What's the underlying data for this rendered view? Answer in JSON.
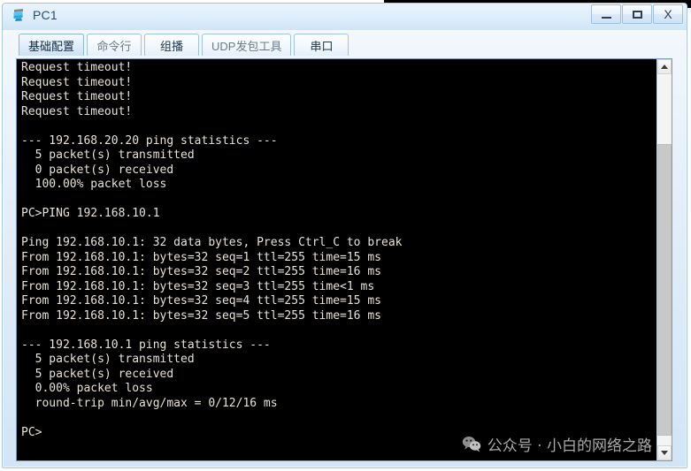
{
  "window": {
    "title": "PC1",
    "icon": "pc-device-icon",
    "controls": [
      {
        "name": "minimize",
        "label": "_"
      },
      {
        "name": "maximize",
        "label": "□"
      },
      {
        "name": "close",
        "label": "X"
      }
    ]
  },
  "tabs": [
    {
      "label": "基础配置",
      "active": true
    },
    {
      "label": "命令行",
      "active": false
    },
    {
      "label": "组播",
      "active": false
    },
    {
      "label": "UDP发包工具",
      "active": false
    },
    {
      "label": "串口",
      "active": false
    }
  ],
  "terminal": {
    "lines": [
      "Request timeout!",
      "Request timeout!",
      "Request timeout!",
      "Request timeout!",
      "",
      "--- 192.168.20.20 ping statistics ---",
      "  5 packet(s) transmitted",
      "  0 packet(s) received",
      "  100.00% packet loss",
      "",
      "PC>PING 192.168.10.1",
      "",
      "Ping 192.168.10.1: 32 data bytes, Press Ctrl_C to break",
      "From 192.168.10.1: bytes=32 seq=1 ttl=255 time=15 ms",
      "From 192.168.10.1: bytes=32 seq=2 ttl=255 time=16 ms",
      "From 192.168.10.1: bytes=32 seq=3 ttl=255 time<1 ms",
      "From 192.168.10.1: bytes=32 seq=4 ttl=255 time=15 ms",
      "From 192.168.10.1: bytes=32 seq=5 ttl=255 time=16 ms",
      "",
      "--- 192.168.10.1 ping statistics ---",
      "  5 packet(s) transmitted",
      "  5 packet(s) received",
      "  0.00% packet loss",
      "  round-trip min/avg/max = 0/12/16 ms",
      "",
      "PC>"
    ],
    "prompt": "PC>",
    "foreground": "#e8e2d8",
    "background": "#000000"
  },
  "scrollbar": {
    "up_arrow": "scroll-up",
    "down_arrow": "scroll-down",
    "thumb_position_percent": 19,
    "thumb_size_percent": 78
  },
  "watermark": {
    "text": "公众号 · 小白的网络之路",
    "icon": "wechat-icon",
    "color": "#b9b9b9"
  }
}
